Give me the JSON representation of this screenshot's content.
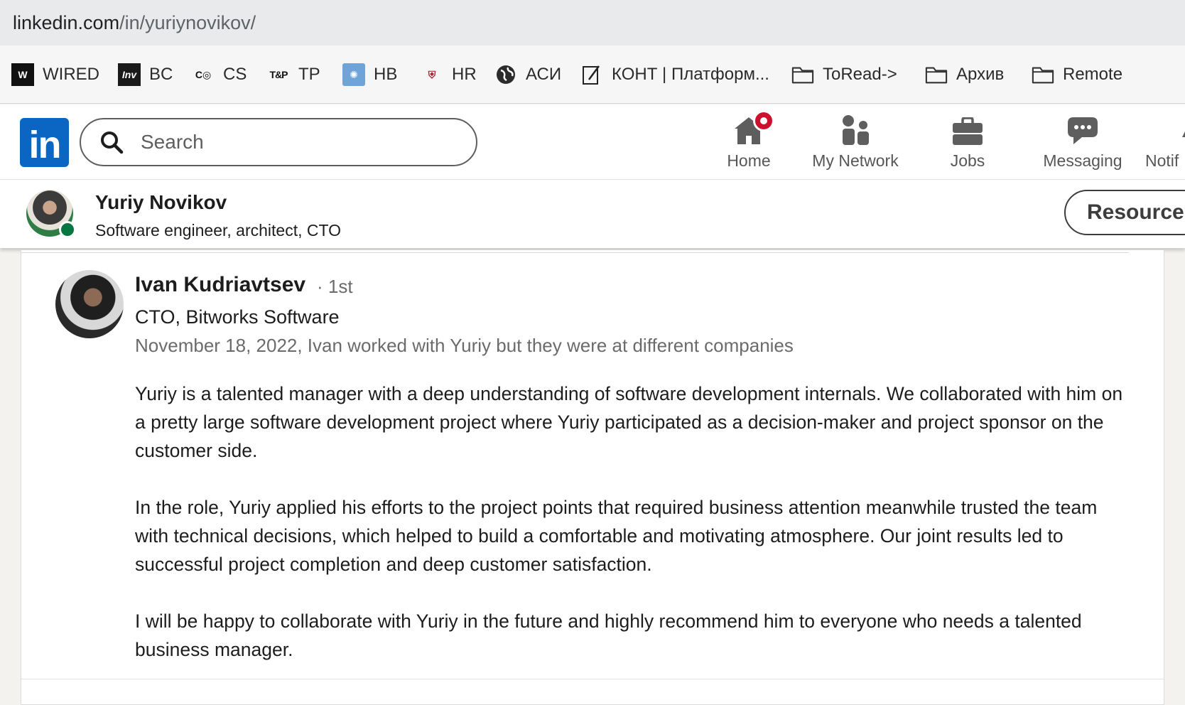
{
  "browser": {
    "url_host": "linkedin.com",
    "url_path": "/in/yuriynovikov/"
  },
  "bookmarks": [
    {
      "label": "WIRED",
      "icon": "wired-icon",
      "glyph": "W"
    },
    {
      "label": "BC",
      "icon": "inv-icon",
      "glyph": "Inv"
    },
    {
      "label": "CS",
      "icon": "cs-icon",
      "glyph": "C◎"
    },
    {
      "label": "TP",
      "icon": "tp-icon",
      "glyph": "T&P"
    },
    {
      "label": "HB",
      "icon": "hb-icon",
      "glyph": "✺"
    },
    {
      "label": "HR",
      "icon": "hr-icon",
      "glyph": "⛨"
    },
    {
      "label": "АСИ",
      "icon": "globe-icon",
      "glyph": "🌍"
    },
    {
      "label": "КОНТ | Платформ...",
      "icon": "kont-icon",
      "glyph": "✎"
    },
    {
      "label": "ToRead->",
      "icon": "folder-icon"
    },
    {
      "label": "Архив",
      "icon": "folder-icon"
    },
    {
      "label": "Remote",
      "icon": "folder-icon"
    }
  ],
  "linkedin": {
    "logo_text": "in",
    "search_placeholder": "Search",
    "nav": {
      "home": "Home",
      "my_network": "My Network",
      "jobs": "Jobs",
      "messaging": "Messaging",
      "notifications": "Notif"
    },
    "colors": {
      "brand": "#0a66c2",
      "badge": "#cb112d",
      "online": "#057642"
    }
  },
  "profile_bar": {
    "name": "Yuriy Novikov",
    "headline": "Software engineer, architect, CTO",
    "resources_button": "Resource"
  },
  "recommendation": {
    "author": "Ivan Kudriavtsev",
    "degree": "· 1st",
    "author_title": "CTO, Bitworks Software",
    "meta": "November 18, 2022, Ivan worked with Yuriy but they were at different companies",
    "paragraphs": [
      "Yuriy is a talented manager with a deep understanding of software development internals. We collaborated with him on a pretty large software development project where Yuriy participated as a decision-maker and project sponsor on the customer side.",
      "In the role, Yuriy applied his efforts to the project points that required business attention meanwhile trusted the team with technical decisions, which helped to build a comfortable and motivating atmosphere. Our joint results led to successful project completion and deep customer satisfaction.",
      "I will be happy to collaborate with Yuriy in the future and highly recommend him to everyone who needs a talented business manager."
    ]
  }
}
